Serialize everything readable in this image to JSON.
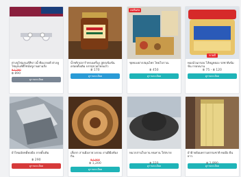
{
  "products": [
    {
      "title": "ต่างหูไข่มุกแท้สีขาวน้ำจืดเกรดดี ต่างหูไข่มุกแท้ดีไซน์หรูงานตามสั่ง",
      "old_price": "฿ 1,290",
      "price": "฿ 890",
      "button": "ดูรายละเอียด"
    },
    {
      "title": "น้ำพริกปลาร้าทรงเครื่อง สูตรเข้มข้นอร่อยดั้งเดิม บรรจุขวดโหลแก้ว",
      "price": "฿ 170",
      "button": "ดูรายละเอียด"
    },
    {
      "badge": "ลดพิเศษ",
      "title": "ชุดของฝากสมุนไพร ไทยโบราณ",
      "price": "฿ 450",
      "button": "ดูรายละเอียด"
    },
    {
      "badge_bottom": "ขายดี",
      "title": "ทองม้วนกรอบ ไส้หมูหยอง รสชาติเข้มข้น กรอบนาน",
      "price": "฿ 75 - ฿ 120",
      "button": "ดูรายละเอียด"
    },
    {
      "title": "ผ้าไหมมัดหมี่ทอมือ ลายดั้งเดิม",
      "price": "฿ 290",
      "button": "ดูรายละเอียด"
    },
    {
      "title": "เสื่อกก สานมือลายวงกลม งานฝีมือท้องถิ่น",
      "old_price": "฿ 1,500",
      "price": "฿ 1,200",
      "button": "ดูรายละเอียด"
    },
    {
      "title": "หมวกสานใบลาน ทนทาน ใส่สบาย",
      "price": "฿ 320",
      "button": "ดูรายละเอียด"
    },
    {
      "title": "ผ้าฝ้ายย้อมครามธรรมชาติ ทอมือ ผืนยาว",
      "price": "฿ 1,890",
      "button": "ดูรายละเอียด"
    }
  ]
}
